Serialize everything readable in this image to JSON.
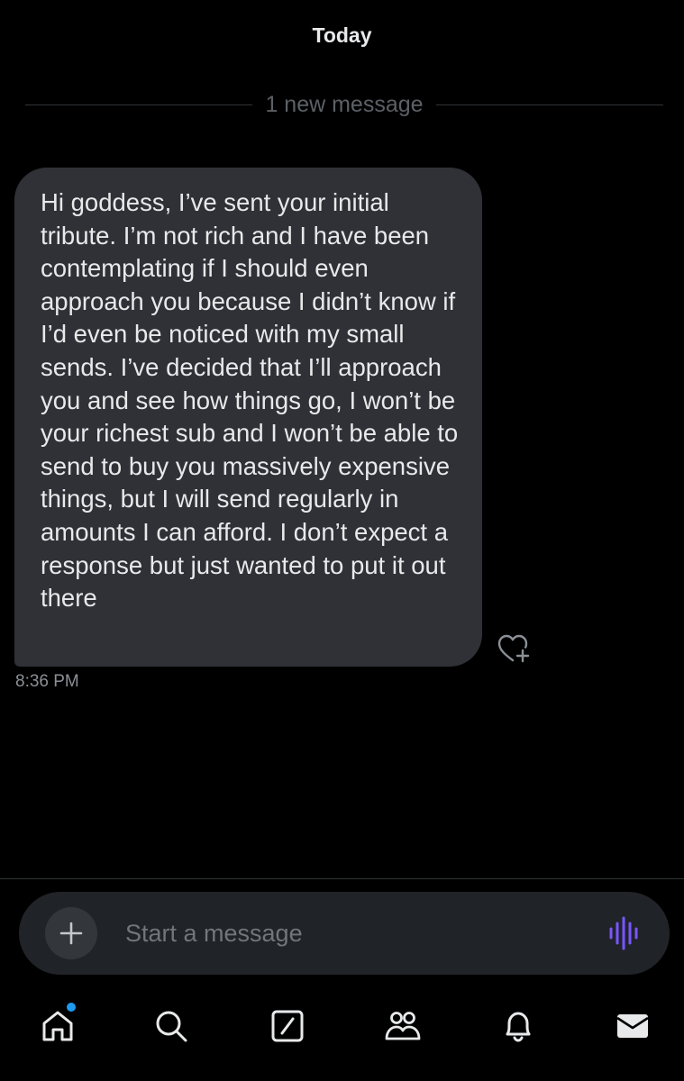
{
  "conversation": {
    "date_label": "Today",
    "new_messages_label": "1 new message",
    "messages": [
      {
        "text": "Hi goddess, I’ve sent your initial tribute. I’m not rich and I have been contemplating if I should even approach you because I didn’t know if I’d even be noticed with my small sends. I’ve decided that I’ll approach you and see how things go, I won’t be your richest sub and I won’t be able to send to buy you massively expensive things, but I will send regularly in amounts I can afford. I don’t expect a response but just wanted to put it out there",
        "time": "8:36 PM",
        "reaction_icon": "heart-add-icon"
      }
    ]
  },
  "composer": {
    "placeholder": "Start a message",
    "add_icon": "plus-icon",
    "voice_icon": "audio-waveform-icon",
    "voice_color": "#7856ff"
  },
  "tabbar": {
    "items": [
      {
        "name": "home",
        "icon": "home-icon",
        "active": true,
        "has_notification_dot": true
      },
      {
        "name": "search",
        "icon": "search-icon"
      },
      {
        "name": "grok",
        "icon": "grok-icon"
      },
      {
        "name": "communities",
        "icon": "people-icon"
      },
      {
        "name": "notifications",
        "icon": "bell-icon"
      },
      {
        "name": "messages",
        "icon": "envelope-icon"
      }
    ],
    "dot_color": "#1d9bf0"
  },
  "colors": {
    "background": "#000000",
    "bubble": "#2f3136",
    "text": "#e7e9ea",
    "muted": "#71767b"
  }
}
